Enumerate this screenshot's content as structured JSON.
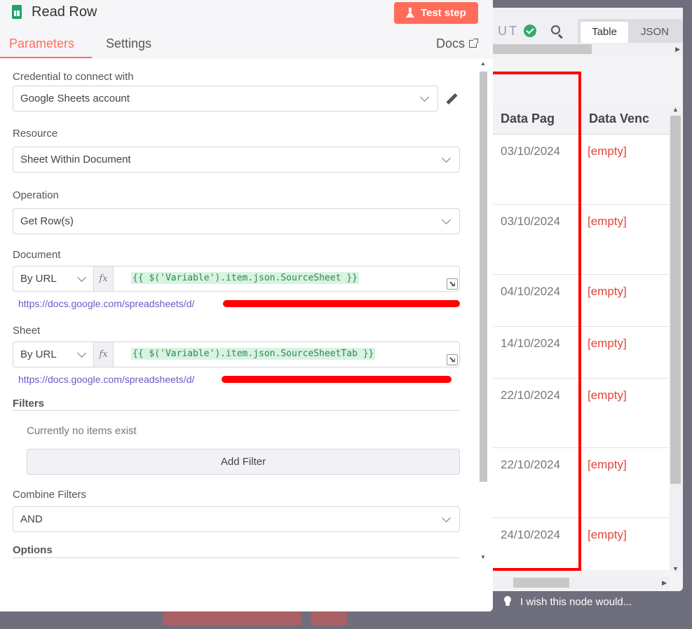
{
  "node": {
    "title": "Read Row",
    "test_button": "Test step",
    "tabs": [
      "Parameters",
      "Settings"
    ],
    "docs_label": "Docs"
  },
  "params": {
    "credential_label": "Credential to connect with",
    "credential_value": "Google Sheets account",
    "resource_label": "Resource",
    "resource_value": "Sheet Within Document",
    "operation_label": "Operation",
    "operation_value": "Get Row(s)",
    "document_label": "Document",
    "document_mode": "By URL",
    "document_expr": "{{ $('Variable').item.json.SourceSheet }}",
    "document_url": "https://docs.google.com/spreadsheets/d/",
    "sheet_label": "Sheet",
    "sheet_mode": "By URL",
    "sheet_expr": "{{ $('Variable').item.json.SourceSheetTab }}",
    "sheet_url": "https://docs.google.com/spreadsheets/d/",
    "fx_label": "fx",
    "filters_label": "Filters",
    "no_items": "Currently no items exist",
    "add_filter": "Add Filter",
    "combine_label": "Combine Filters",
    "combine_value": "AND",
    "options_label": "Options"
  },
  "output": {
    "header_partial": "UT",
    "view_tabs": [
      "Table",
      "JSON"
    ],
    "columns": [
      "Data Pag",
      "Data Venc"
    ],
    "rows": [
      {
        "date": "03/10/2024",
        "venc": "[empty]"
      },
      {
        "date": "03/10/2024",
        "venc": "[empty]"
      },
      {
        "date": "04/10/2024",
        "venc": "[empty]"
      },
      {
        "date": "14/10/2024",
        "venc": "[empty]"
      },
      {
        "date": "22/10/2024",
        "venc": "[empty]"
      },
      {
        "date": "22/10/2024",
        "venc": "[empty]"
      },
      {
        "date": "24/10/2024",
        "venc": "[empty]"
      }
    ],
    "feedback": "I wish this node would..."
  },
  "colors": {
    "accent": "#ff6d5a",
    "empty": "#e0453c",
    "highlight": "#ff0000"
  }
}
